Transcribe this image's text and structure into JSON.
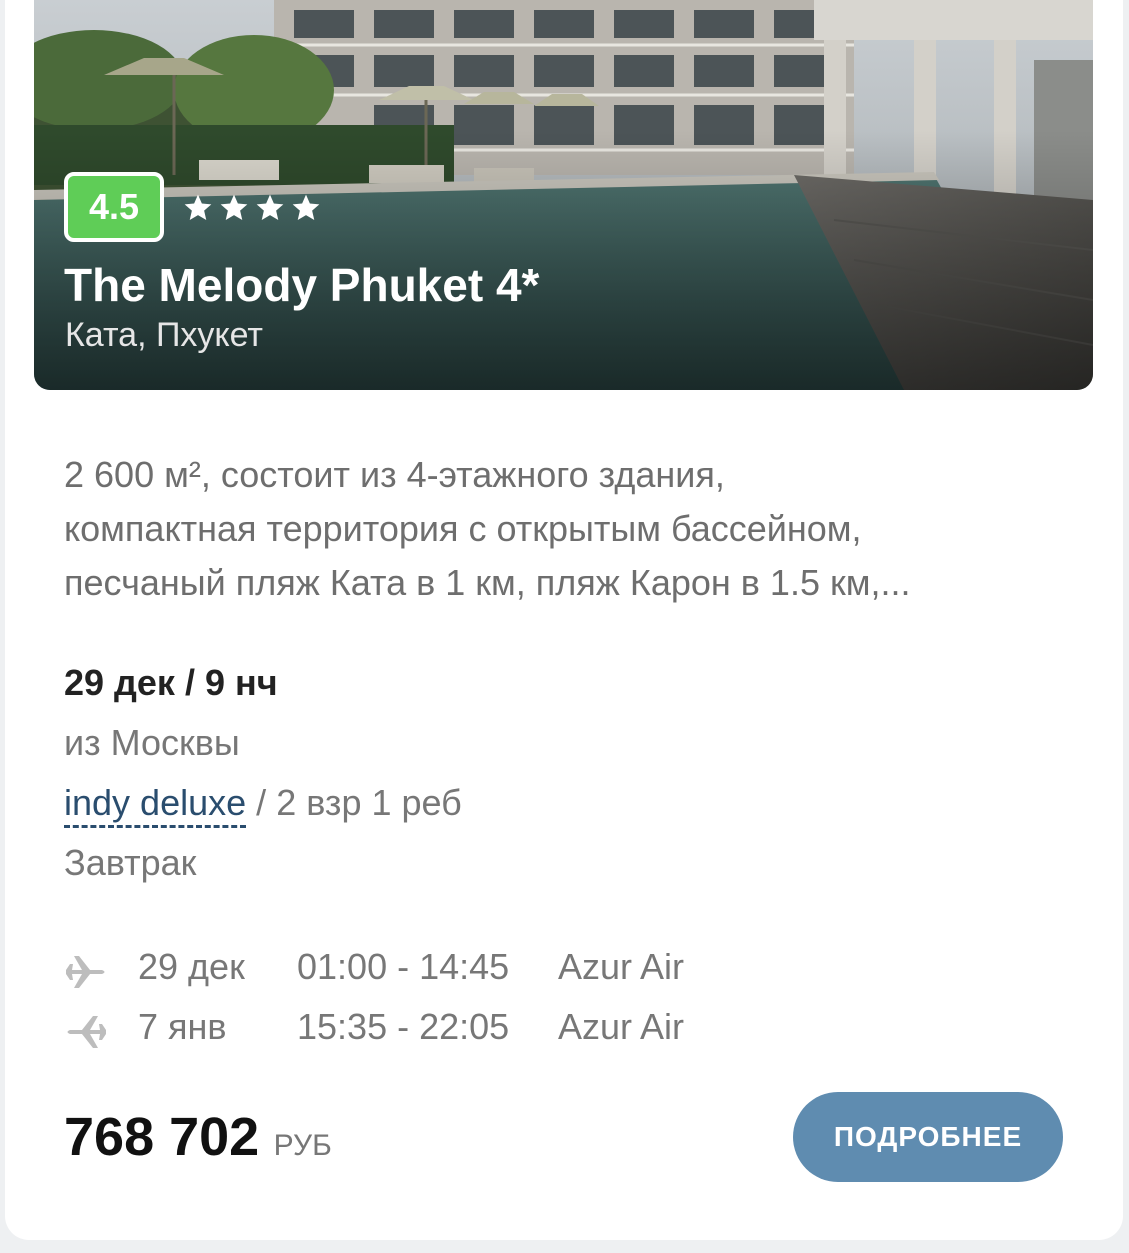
{
  "hotel": {
    "rating": "4.5",
    "stars": 4,
    "name": "The Melody Phuket 4*",
    "location": "Ката, Пхукет",
    "image_icon": "hotel-pool-photo"
  },
  "description": {
    "lines": [
      "2 600 м², состоит из 4-этажного здания,",
      "компактная территория с открытым бассейном,",
      "песчаный пляж Ката в 1 км, пляж Карон в 1.5 км,..."
    ]
  },
  "tour": {
    "dates_nights": "29 дек / 9 нч",
    "from_city": "из Москвы",
    "room_type": "indy deluxe",
    "separator": "/",
    "pax": "2 взр 1 реб",
    "meal": "Завтрак"
  },
  "flights": [
    {
      "direction_icon": "plane-departure-icon",
      "date": "29 дек",
      "time": "01:00 - 14:45",
      "airline": "Azur Air"
    },
    {
      "direction_icon": "plane-return-icon",
      "date": "7 янв",
      "time": "15:35 - 22:05",
      "airline": "Azur Air"
    }
  ],
  "price": {
    "value": "768 702",
    "currency": "РУБ"
  },
  "actions": {
    "details_label": "ПОДРОБНЕЕ"
  },
  "colors": {
    "rating_badge": "#5fcd57",
    "button": "#5f8cb0",
    "room_link": "#2a4d6e"
  }
}
